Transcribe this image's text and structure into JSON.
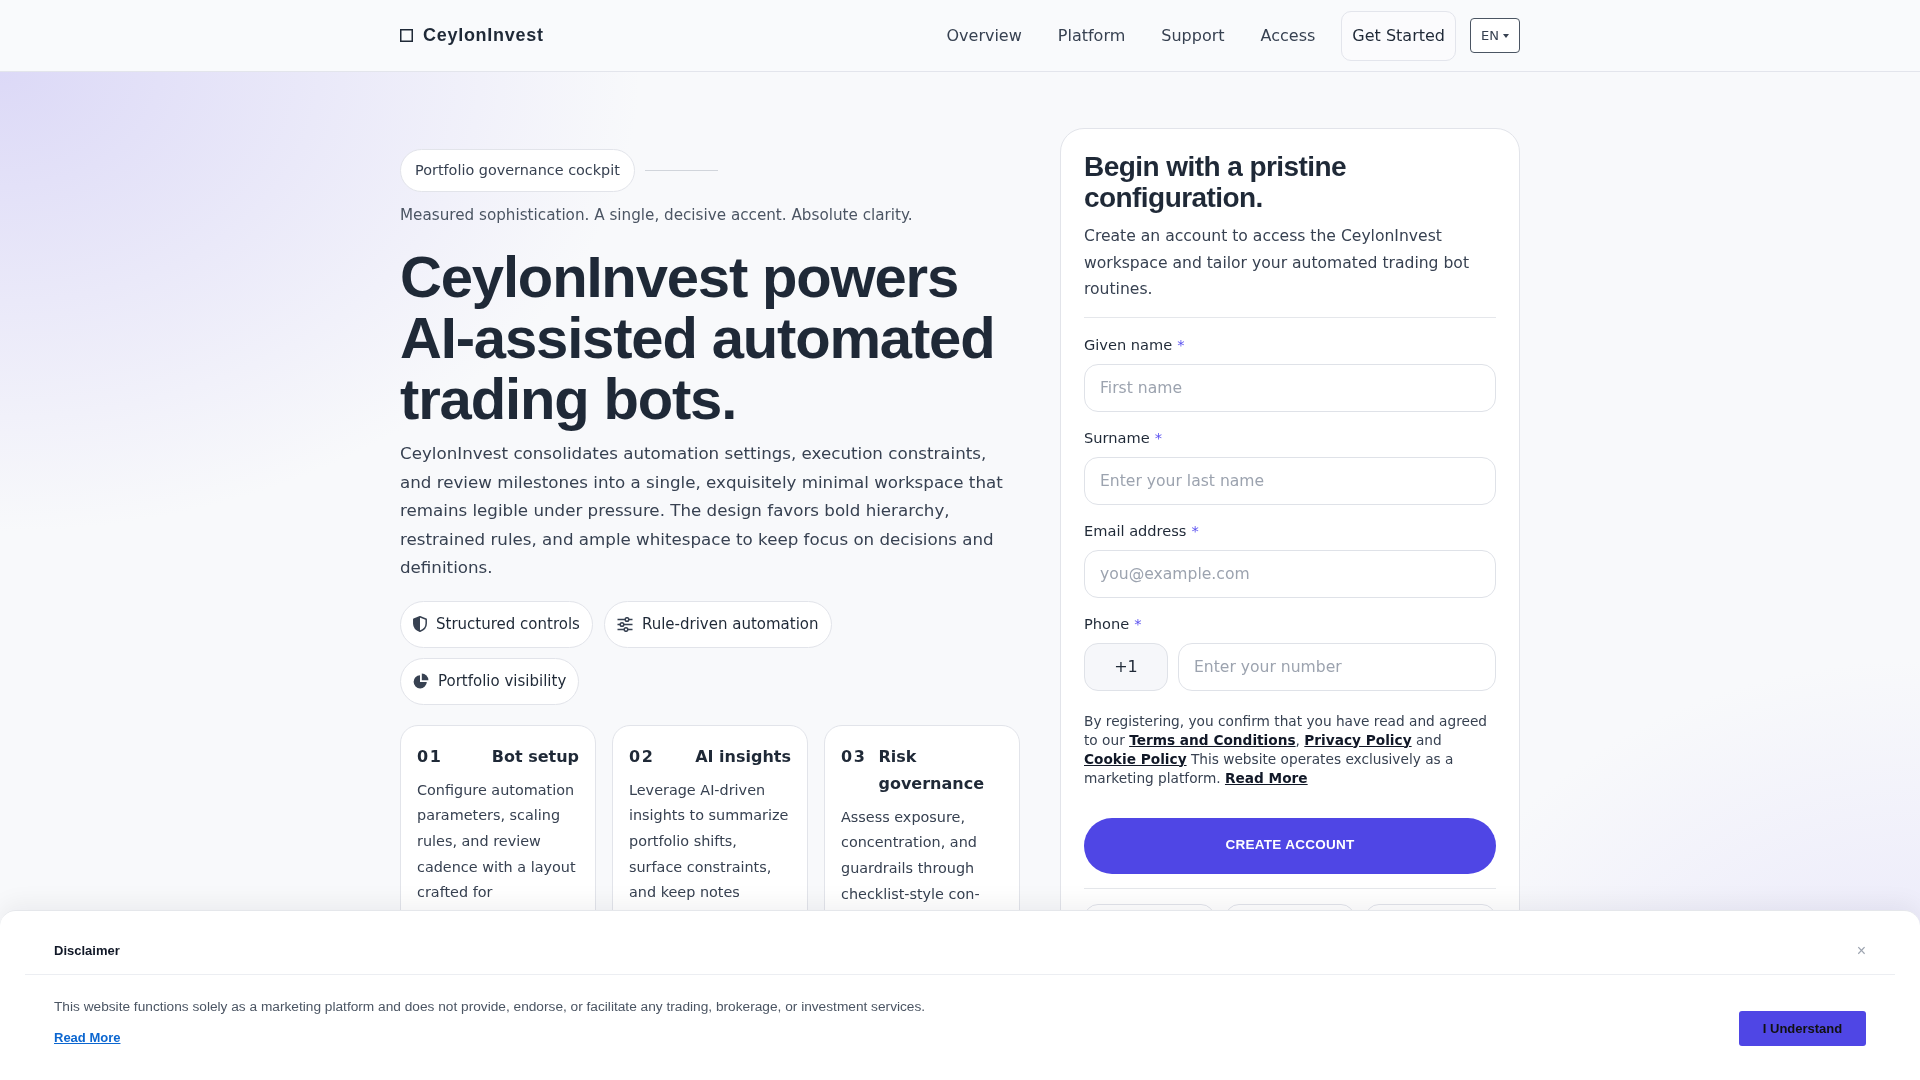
{
  "header": {
    "brand": "CeylonInvest",
    "nav": [
      "Overview",
      "Platform",
      "Support",
      "Access"
    ],
    "cta": "Get Started",
    "language": "EN"
  },
  "hero": {
    "eyebrow": "Portfolio governance cockpit",
    "tagline": "Measured sophistication. A single, decisive accent. Absolute clarity.",
    "headline": "CeylonInvest powers AI-assisted automated trading bots.",
    "description": "CeylonInvest consolidates automation settings, execution constraints, and review milestones into a single, exquisitely minimal workspace that remains legible under pressure. The design favors bold hierarchy, restrained rules, and ample whitespace to keep focus on decisions and definitions.",
    "features": [
      {
        "label": "Structured controls"
      },
      {
        "label": "Rule-driven automation"
      },
      {
        "label": "Portfolio visibility"
      }
    ],
    "steps": [
      {
        "number": "01",
        "title": "Bot setup",
        "text": "Configure automation parameters, scaling rules, and review cadence with a layout crafted for"
      },
      {
        "number": "02",
        "title": "AI insights",
        "text": "Leverage AI-driven insights to summarize portfolio shifts, surface constraints, and keep notes"
      },
      {
        "number": "03",
        "title": "Risk governance",
        "text": "Assess exposure, concentration, and guardrails through checklist-style con-"
      }
    ]
  },
  "signup": {
    "title": "Begin with a pristine configuration.",
    "intro": "Create an account to access the CeylonInvest workspace and tailor your automated trading bot routines.",
    "fields": [
      {
        "kind": "text",
        "label": "Given name",
        "mark": "*",
        "placeholder": "First name"
      },
      {
        "kind": "text",
        "label": "Surname",
        "mark": "*",
        "placeholder": "Enter your last name"
      },
      {
        "kind": "text",
        "label": "Email address",
        "mark": "*",
        "placeholder": "you@example.com"
      },
      {
        "kind": "phone",
        "label": "Phone",
        "mark": "*",
        "prefix": "+1",
        "placeholder": "Enter your number"
      }
    ],
    "legal": [
      {
        "kind": "text",
        "text": "By registering, you confirm that you have read and agreed to our "
      },
      {
        "kind": "link",
        "text": "Terms and Conditions"
      },
      {
        "kind": "text",
        "text": ", "
      },
      {
        "kind": "link",
        "text": "Privacy Policy"
      },
      {
        "kind": "text",
        "text": " and "
      },
      {
        "kind": "link",
        "text": "Cookie Policy"
      },
      {
        "kind": "text",
        "text": " This website operates exclusively as a marketing platform. "
      },
      {
        "kind": "link",
        "text": "Read More"
      }
    ],
    "submit": "CREATE ACCOUNT"
  },
  "disclaimer": {
    "title": "Disclaimer",
    "close": "×",
    "text": "This website functions solely as a marketing platform and does not provide, endorse, or facilitate any trading, brokerage, or investment services.",
    "link": "Read More",
    "button": "I Understand"
  }
}
